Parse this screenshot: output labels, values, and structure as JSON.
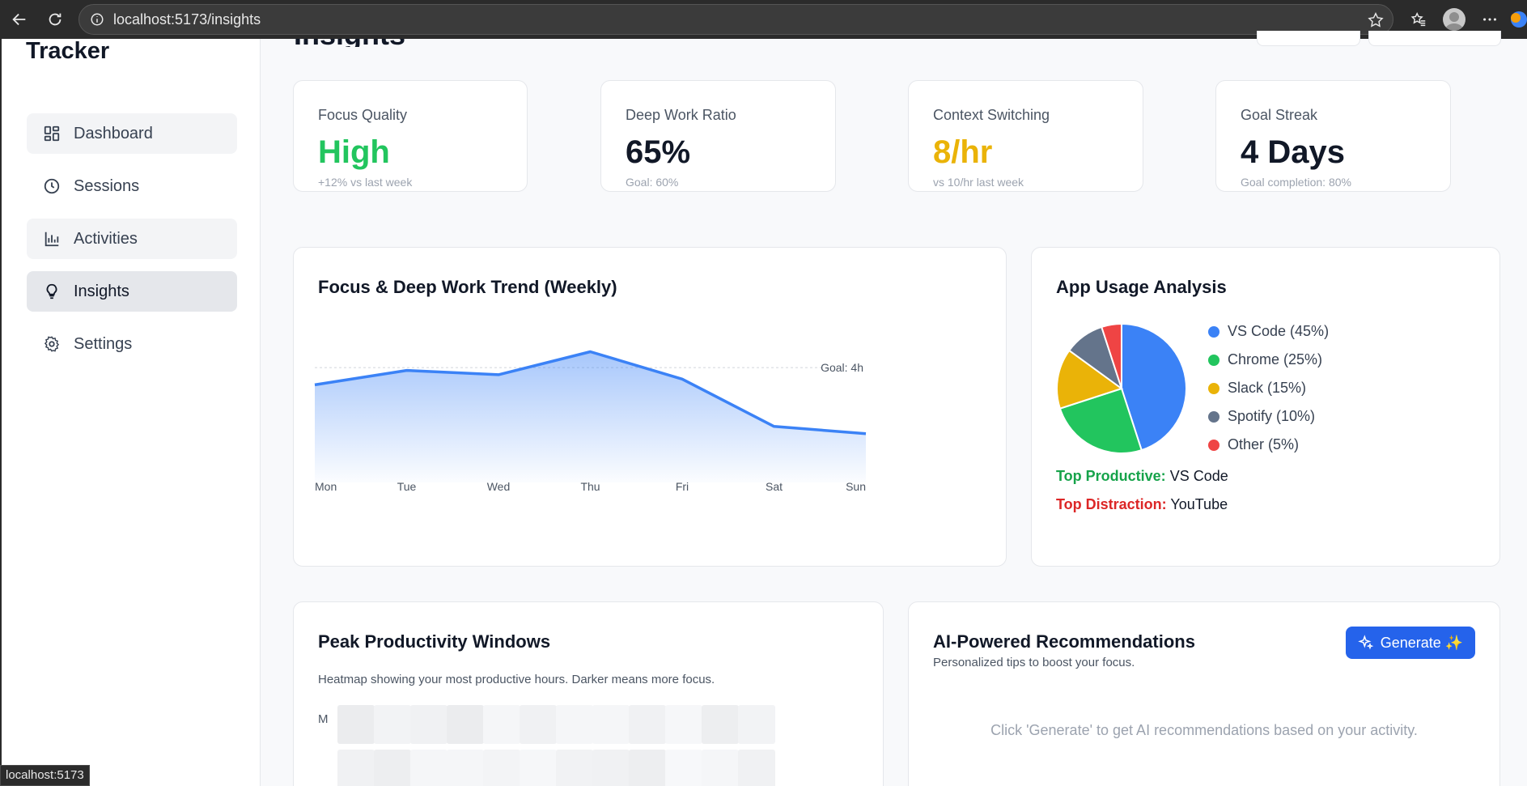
{
  "browser": {
    "url": "localhost:5173/insights",
    "status_url": "localhost:5173"
  },
  "sidebar": {
    "brand": "Tracker",
    "items": [
      {
        "label": "Dashboard",
        "icon": "dashboard-icon"
      },
      {
        "label": "Sessions",
        "icon": "clock-icon"
      },
      {
        "label": "Activities",
        "icon": "bar-chart-icon"
      },
      {
        "label": "Insights",
        "icon": "lightbulb-icon",
        "selected": true
      },
      {
        "label": "Settings",
        "icon": "gear-icon"
      }
    ]
  },
  "page": {
    "title": "Insights"
  },
  "stats": [
    {
      "label": "Focus Quality",
      "value": "High",
      "sub": "+12% vs last week",
      "color": "#22c55e"
    },
    {
      "label": "Deep Work Ratio",
      "value": "65%",
      "sub": "Goal: 60%",
      "color": "#111827"
    },
    {
      "label": "Context Switching",
      "value": "8/hr",
      "sub": "vs 10/hr last week",
      "color": "#eab308"
    },
    {
      "label": "Goal Streak",
      "value": "4 Days",
      "sub": "Goal completion: 80%",
      "color": "#111827"
    }
  ],
  "trend": {
    "title": "Focus & Deep Work Trend (Weekly)",
    "goal_label": "Goal: 4h",
    "line_color": "#3b82f6"
  },
  "chart_data": {
    "type": "area",
    "title": "Focus & Deep Work Trend (Weekly)",
    "categories": [
      "Mon",
      "Tue",
      "Wed",
      "Thu",
      "Fri",
      "Sat",
      "Sun"
    ],
    "values": [
      3.4,
      3.9,
      3.75,
      4.55,
      3.6,
      1.95,
      1.7
    ],
    "goal": 4,
    "goal_label": "Goal: 4h",
    "ylim": [
      0,
      6.2
    ],
    "grid": false
  },
  "app_usage": {
    "title": "App Usage Analysis",
    "slices": [
      {
        "name": "VS Code",
        "label": "VS Code (45%)",
        "value": 45,
        "color": "#3b82f6"
      },
      {
        "name": "Chrome",
        "label": "Chrome (25%)",
        "value": 25,
        "color": "#22c55e"
      },
      {
        "name": "Slack",
        "label": "Slack (15%)",
        "value": 15,
        "color": "#eab308"
      },
      {
        "name": "Spotify",
        "label": "Spotify (10%)",
        "value": 10,
        "color": "#64748b"
      },
      {
        "name": "Other",
        "label": "Other (5%)",
        "value": 5,
        "color": "#ef4444"
      }
    ],
    "top_productive_key": "Top Productive:",
    "top_productive_value": "VS Code",
    "top_distraction_key": "Top Distraction:",
    "top_distraction_value": "YouTube"
  },
  "peak": {
    "title": "Peak Productivity Windows",
    "description": "Heatmap showing your most productive hours. Darker means more focus.",
    "rows": [
      {
        "label": "M",
        "levels": [
          0.5,
          0.2,
          0.3,
          0.5,
          0.1,
          0.3,
          0.1,
          0.1,
          0.3,
          0.05,
          0.4,
          0.2
        ]
      },
      {
        "label": "",
        "levels": [
          0.3,
          0.4,
          0.1,
          0.1,
          0.15,
          0.05,
          0.25,
          0.3,
          0.4,
          0.0,
          0.1,
          0.3
        ]
      }
    ]
  },
  "ai": {
    "title": "AI-Powered Recommendations",
    "subtitle": "Personalized tips to boost your focus.",
    "button_label": "Generate ✨",
    "empty": "Click 'Generate' to get AI recommendations based on your activity."
  }
}
